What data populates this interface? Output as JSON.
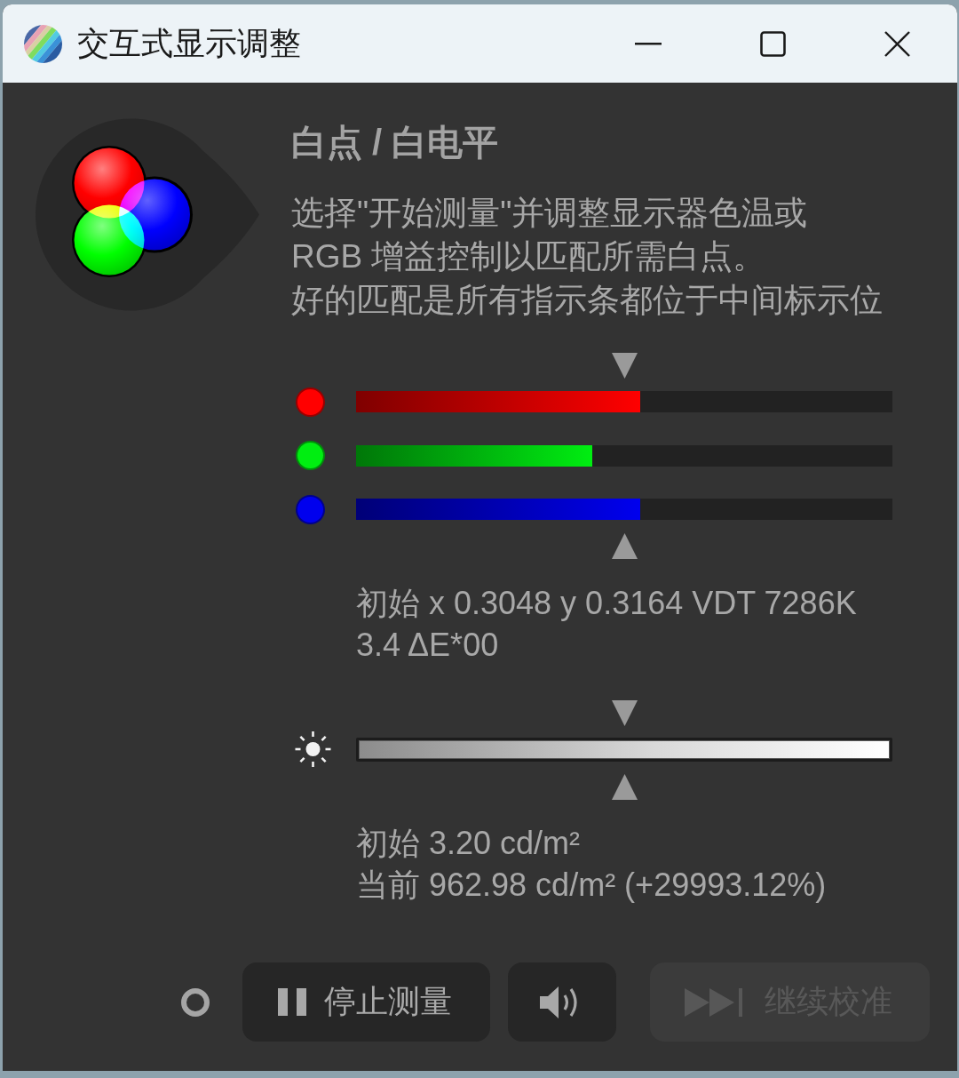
{
  "window": {
    "title": "交互式显示调整"
  },
  "section": {
    "heading": "白点 / 白电平",
    "description": [
      "选择\"开始测量\"并调整显示器色温或",
      "RGB 增益控制以匹配所需白点。",
      "好的匹配是所有指示条都位于中间标示位"
    ]
  },
  "channels": [
    {
      "color": "#ff0000",
      "level": 0.53
    },
    {
      "color": "#00ee11",
      "level": 0.44
    },
    {
      "color": "#0000ee",
      "level": 0.53
    }
  ],
  "chromaticity_reading": [
    "初始 x 0.3048 y 0.3164 VDT 7286K",
    "3.4 ΔE*00"
  ],
  "luminance": {
    "level": 1,
    "reading": [
      "初始 3.20 cd/m²",
      "当前 962.98 cd/m² (+29993.12%)"
    ]
  },
  "buttons": [
    {
      "kind": "pause",
      "label": "停止测量",
      "disabled": false
    },
    {
      "kind": "sound",
      "disabled": false
    },
    {
      "kind": "skip",
      "label": "继续校准",
      "disabled": true
    }
  ]
}
